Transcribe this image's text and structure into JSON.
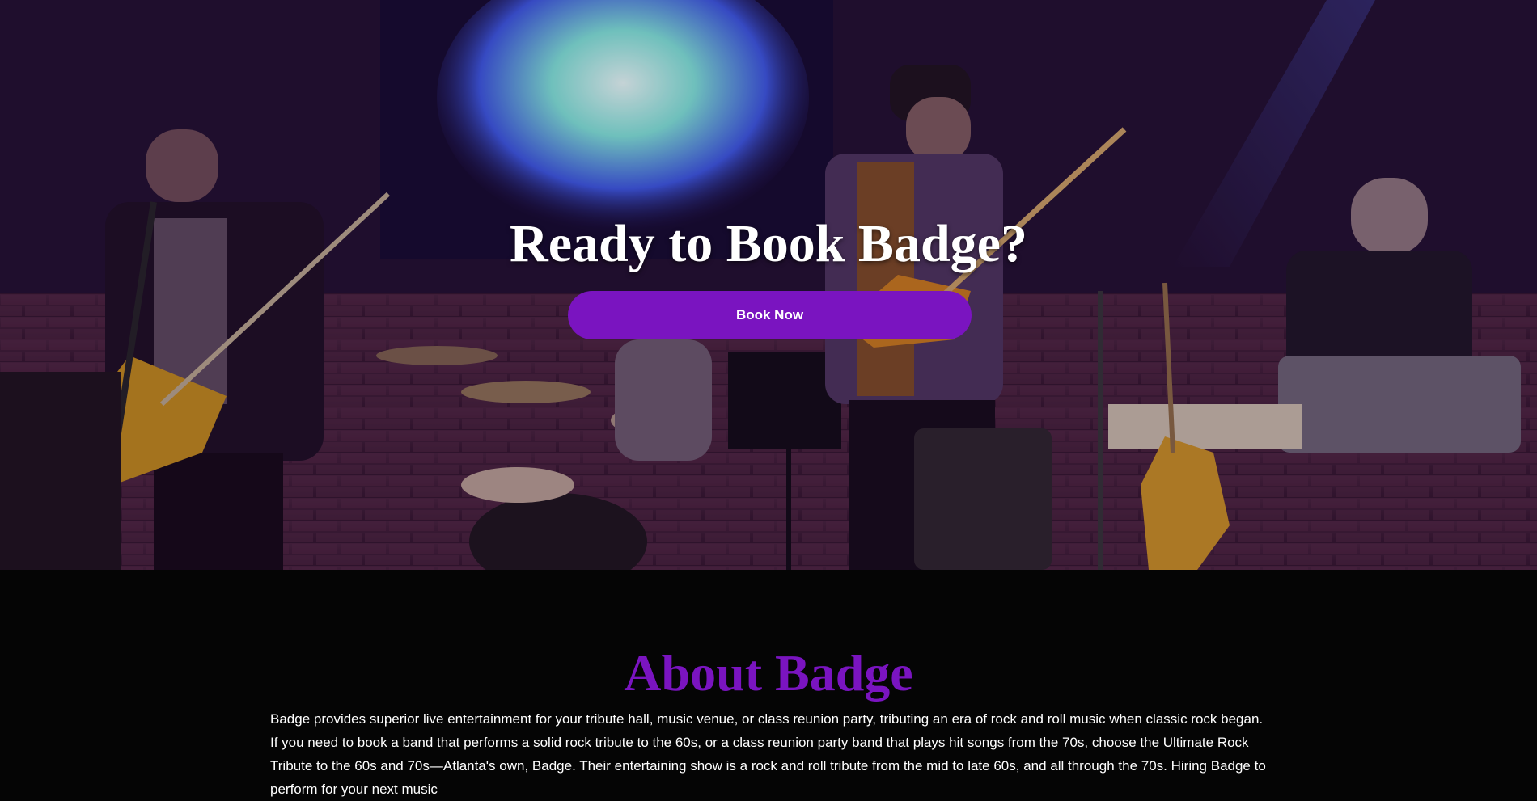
{
  "hero": {
    "title": "Ready to Book Badge?",
    "button_label": "Book Now",
    "photo_alt": "Badge band performing live on stage"
  },
  "about": {
    "title": "About Badge",
    "paragraph": "Badge provides superior live entertainment for your tribute hall, music venue, or class reunion party, tributing an era of rock and roll music when classic rock began. If you need to book a band that performs a solid rock tribute to the 60s, or a class reunion party band that plays hit songs from the 70s, choose the Ultimate Rock Tribute to the 60s and 70s—Atlanta's own, Badge. Their entertaining show is a rock and roll tribute from the mid to late 60s, and all through the 70s. Hiring Badge to perform for your next music"
  },
  "colors": {
    "accent": "#7a14c0",
    "background": "#050505",
    "text": "#ffffff"
  }
}
